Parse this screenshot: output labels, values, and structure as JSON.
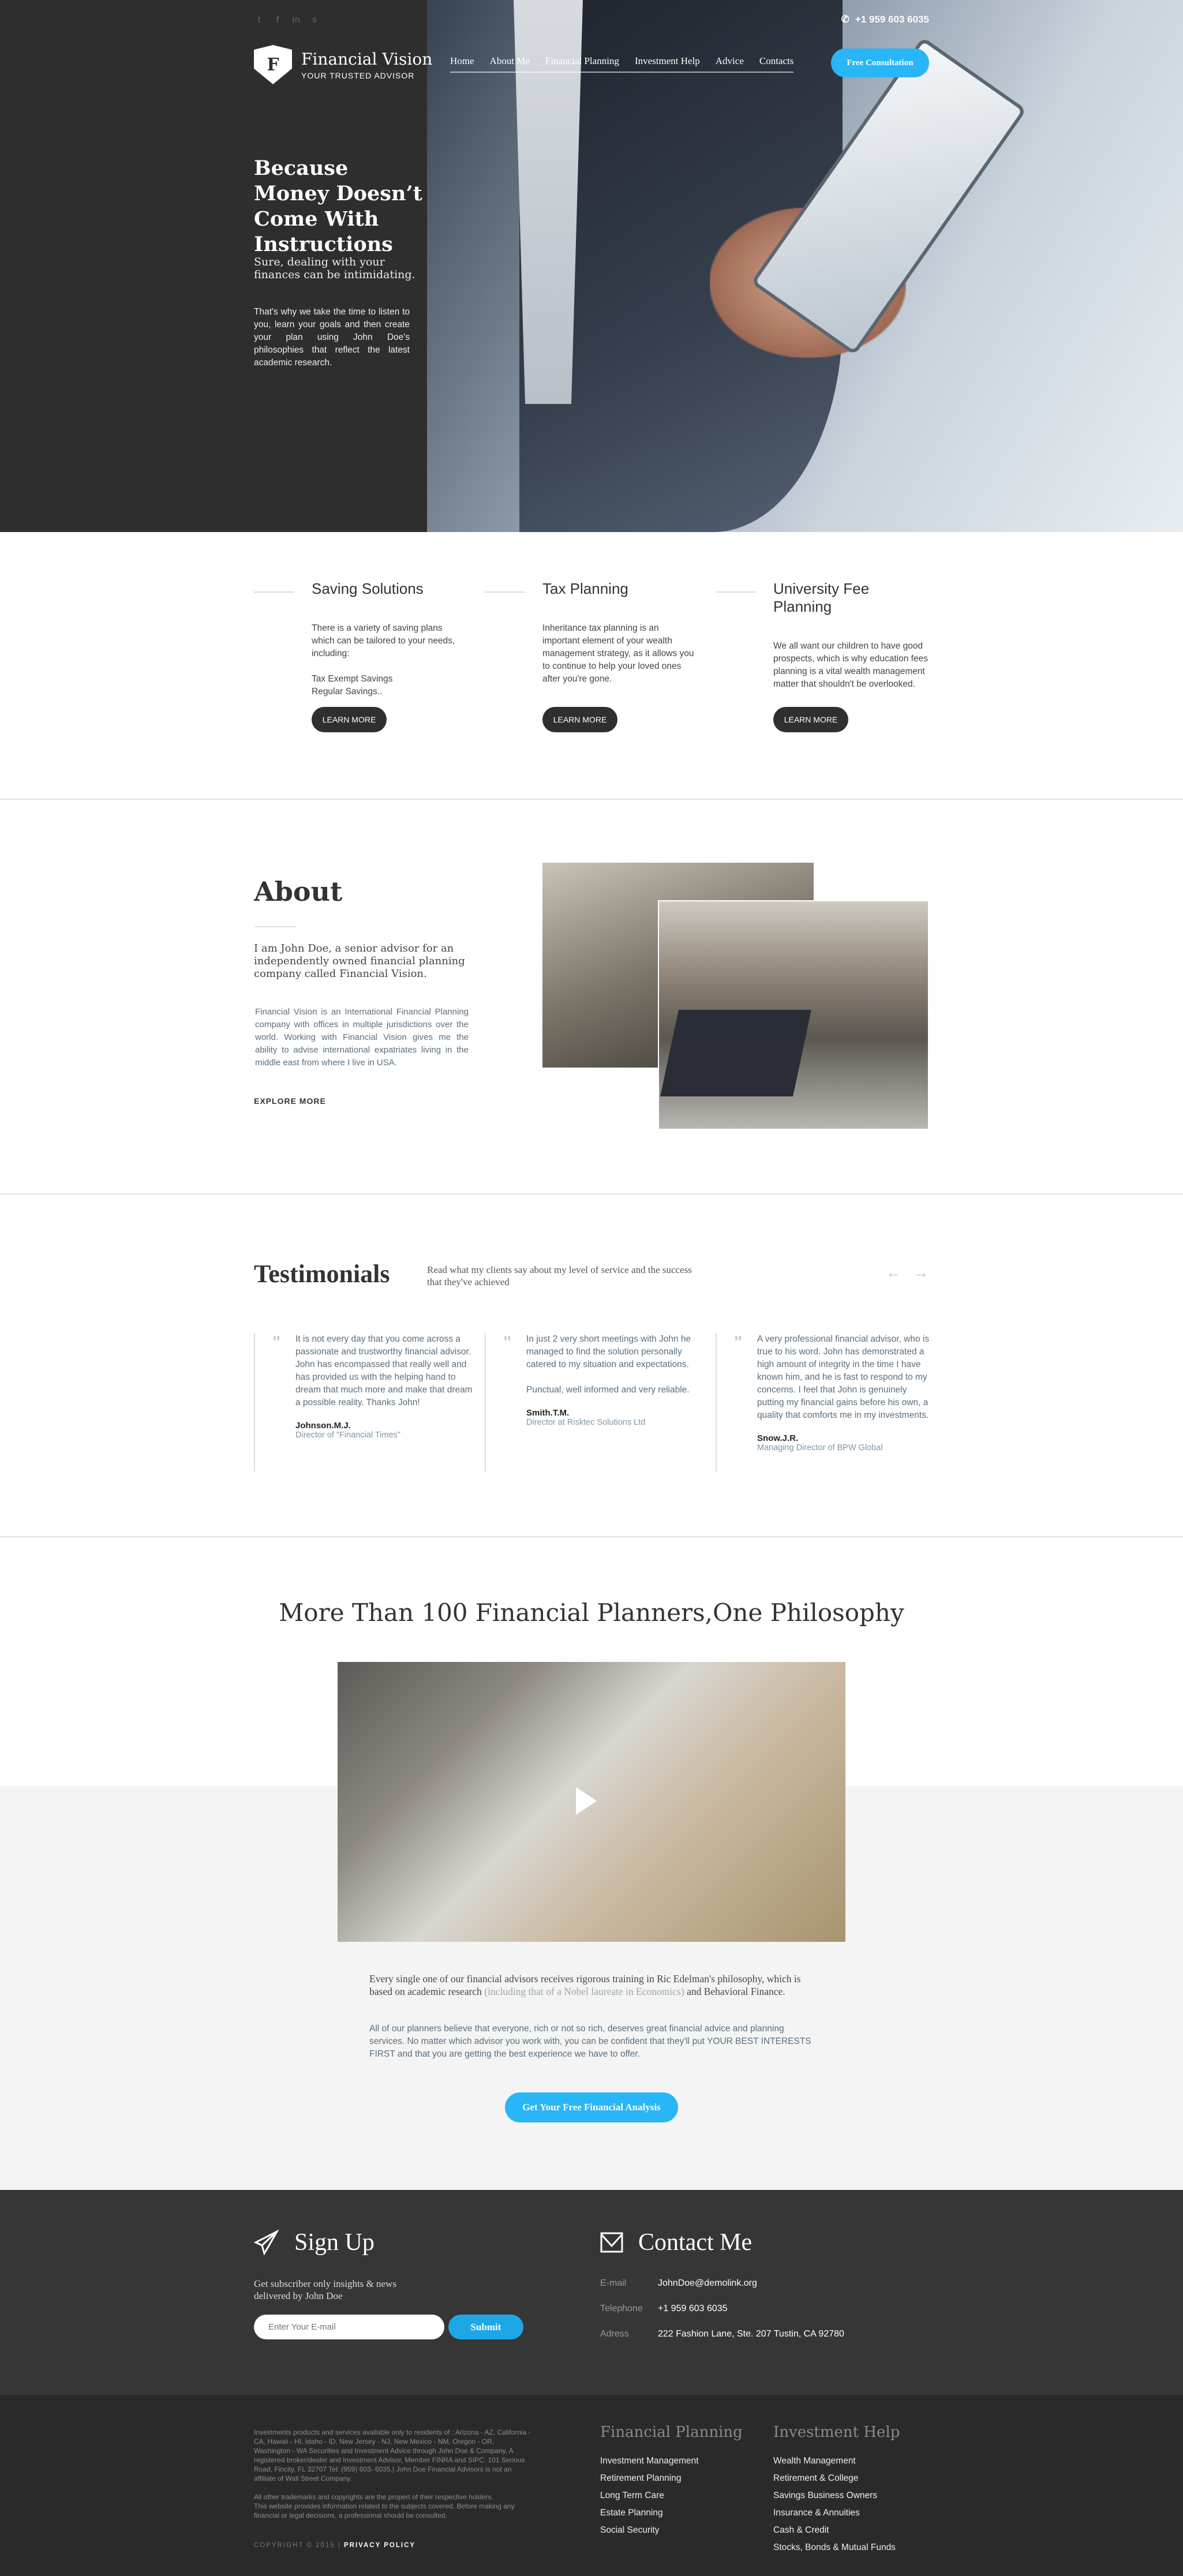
{
  "header": {
    "social": [
      "twitter-icon",
      "facebook-icon",
      "linkedin-icon",
      "skype-icon"
    ],
    "phone": "+1 959 603 6035",
    "brand": "Financial Vision",
    "logo_letter": "F",
    "tagline": "YOUR TRUSTED ADVISOR",
    "nav": [
      "Home",
      "About Me",
      "Financial Planning",
      "Investment Help",
      "Advice",
      "Contacts"
    ],
    "cta": "Free Consultation"
  },
  "hero": {
    "title": "Because Money Doesn’t Come With Instructions",
    "subtitle": "Sure, dealing with your finances can be intimidating.",
    "text": "That's why we take the time to listen to you, learn your goals and then create your plan using John Doe's philosophies that reflect the latest academic research."
  },
  "services": [
    {
      "title": "Saving Solutions",
      "text": "There is a variety of saving plans which can be tailored to your needs, including:\n\nTax Exempt Savings\nRegular Savings..",
      "button": "LEARN MORE"
    },
    {
      "title": "Tax Planning",
      "text": "Inheritance tax planning is an important element of your wealth management strategy, as it allows you to continue to help your loved ones after you're gone.",
      "button": "LEARN MORE"
    },
    {
      "title": "University Fee Planning",
      "text": "We all want our children to have good prospects, which is why education fees planning is a vital wealth management matter that shouldn't be overlooked.",
      "button": "LEARN MORE"
    }
  ],
  "about": {
    "title": "About",
    "lead": "I am John Doe, a senior advisor for an independently owned financial planning company called Financial Vision.",
    "text": "Financial Vision is an International Financial Planning company with offices in multiple jurisdictions over the world. Working with Financial Vision gives me the ability to advise international expatriates living in the middle east from where I live in USA.",
    "link": "EXPLORE MORE"
  },
  "testimonials": {
    "title": "Testimonials",
    "subtitle": "Read what my clients say about my level of service and the success that they've achieved",
    "items": [
      {
        "text": "It is not every day that you come across a passionate and trustworthy financial advisor. John has encompassed that really well and has provided us with the helping hand to dream that much more and make that dream a possible reality. Thanks John!",
        "name": "Johnson.M.J.",
        "role": "Director of \"Financial Times\""
      },
      {
        "text": "In just 2 very short meetings with John he managed to find the solution personally catered to my situation and expectations.\n\nPunctual, well informed and very reliable.",
        "name": "Smith.T.M.",
        "role": "Director at Risktec Solutions Ltd"
      },
      {
        "text": "A very professional financial advisor, who is true to his word. John has demonstrated a high amount of integrity in the time I have known him, and he is fast to respond to my concerns. I feel that John is genuinely putting my financial gains before his own, a quality that comforts me in my investments.",
        "name": "Snow.J.R.",
        "role": "Managing Director of BPW Global"
      }
    ]
  },
  "philosophy": {
    "title": "More Than 100 Financial Planners,One Philosophy",
    "p1_a": "Every single one of our financial advisors receives rigorous training in Ric Edelman's philosophy, which is based on academic research ",
    "p1_highlight": "(including that of a Nobel laureate in Economics)",
    "p1_b": " and Behavioral Finance.",
    "p2": "All of our planners believe that everyone, rich or not so rich, deserves great financial advice and planning services. No matter which advisor you work with, you can be confident that they'll put YOUR BEST INTERESTS FIRST and that you are getting the best experience we have to offer.",
    "cta": "Get Your Free Financial Analysis"
  },
  "signup": {
    "title": "Sign Up",
    "text": "Get subscriber only insights & news delivered by John Doe",
    "placeholder": "Enter Your E-mail",
    "submit": "Submit"
  },
  "contact": {
    "title": "Contact Me",
    "rows": [
      {
        "label": "E-mail",
        "value": "JohnDoe@demolink.org"
      },
      {
        "label": "Telephone",
        "value": "+1 959 603 6035"
      },
      {
        "label": "Adress",
        "value": "222 Fashion Lane, Ste. 207 Tustin, CA 92780"
      }
    ]
  },
  "footer": {
    "legal": "Investments products and services available only to residents of : Arizona - AZ, California - CA, Hawaii - HI, Idaho - ID, New Jersey - NJ, New Mexico - NM, Oregon - OR, Washington - WA Securities and Investment Advice through John Doe & Company, A registered broker/dealer and Investment Advisor, Member FINRA and SIPC. 101 Serious Road, Fincity, FL 32707 Tel: (959) 603- 6035.| John Doe Financial Advisors is not an affiliate of Wall Street Company.\n\nAll other trademarks and copyrights are the propert of their respective holders.\nThis website provides information related to the subjects covered. Before making any financial or legal decisions, a professional should be consulted.",
    "copyright": "COPYRIGHT © 2015 | ",
    "privacy": "PRIVACY POLICY",
    "col1": {
      "title": "Financial Planning",
      "items": [
        "Investment Management",
        "Retirement Planning",
        "Long Term Care",
        "Estate Planning",
        "Social Security"
      ]
    },
    "col2": {
      "title": "Investment Help",
      "items": [
        "Wealth Management",
        "Retirement & College",
        "Savings Business Owners",
        "Insurance & Annuities",
        "Cash & Credit",
        "Stocks, Bonds & Mutual Funds"
      ]
    }
  },
  "colors": {
    "accent": "#29b6f6",
    "dark": "#2e2e2e",
    "footer": "#2a2a2a"
  }
}
